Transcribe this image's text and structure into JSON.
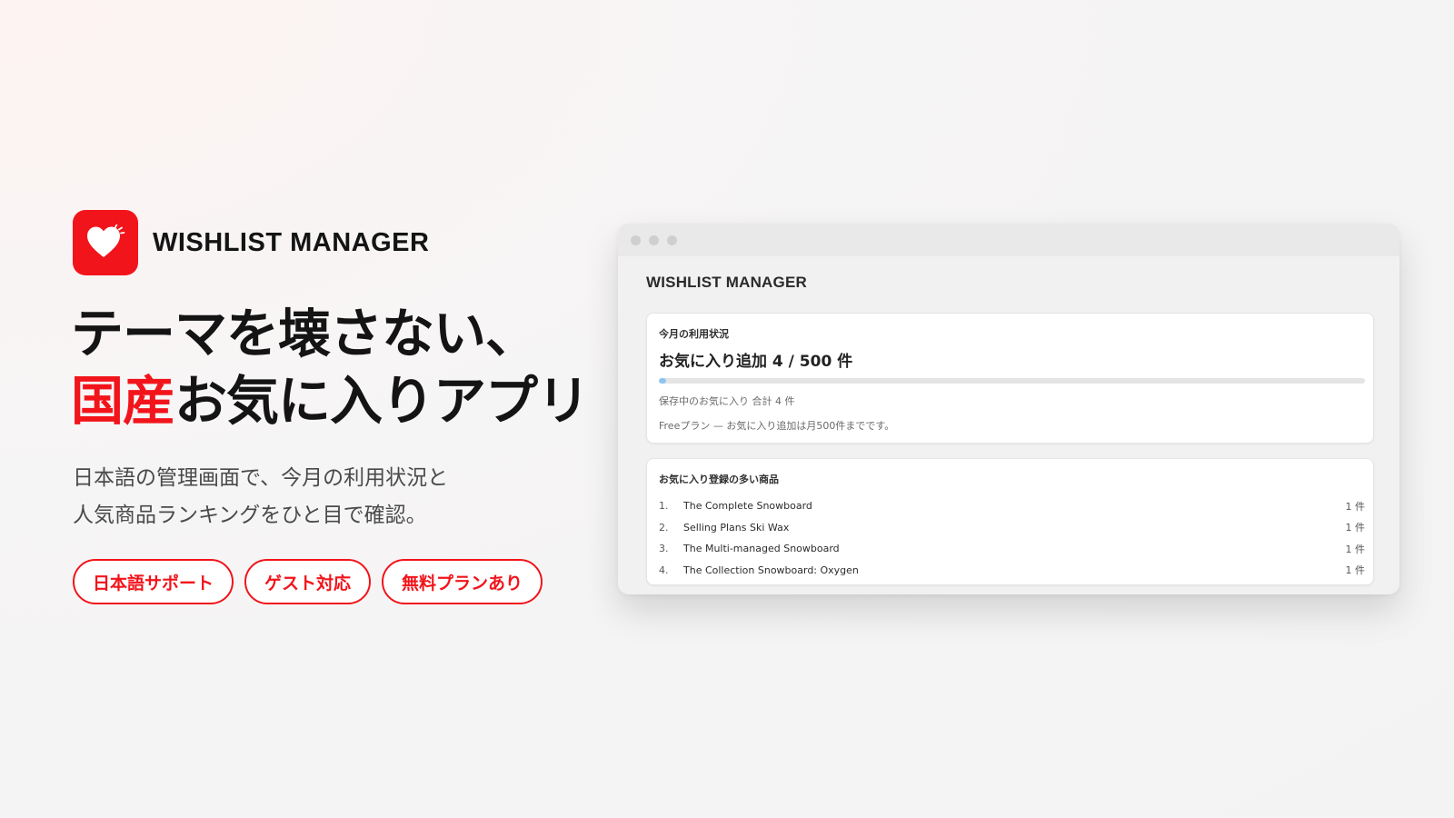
{
  "brand": {
    "name": "WISHLIST MANAGER",
    "logo_icon": "heart-icon",
    "accent_color": "#f2141b"
  },
  "hero": {
    "headline_line1": "テーマを壊さない、",
    "headline_accent": "国産",
    "headline_line2_rest": "お気に入りアプリ",
    "lead_line1": "日本語の管理画面で、今月の利用状況と",
    "lead_line2": "人気商品ランキングをひと目で確認。",
    "pills": [
      "日本語サポート",
      "ゲスト対応",
      "無料プランあり"
    ]
  },
  "window": {
    "app_title": "WISHLIST MANAGER",
    "usage": {
      "title": "今月の利用状況",
      "headline": "お気に入り追加 4 / 500 件",
      "used": 4,
      "limit": 500,
      "saved_text": "保存中のお気に入り 合計 4 件",
      "plan_text": "Freeプラン — お気に入り追加は月500件までです。"
    },
    "ranking": {
      "title": "お気に入り登録の多い商品",
      "items": [
        {
          "rank": "1.",
          "name": "The Complete Snowboard",
          "count": "1 件"
        },
        {
          "rank": "2.",
          "name": "Selling Plans Ski Wax",
          "count": "1 件"
        },
        {
          "rank": "3.",
          "name": "The Multi-managed Snowboard",
          "count": "1 件"
        },
        {
          "rank": "4.",
          "name": "The Collection Snowboard: Oxygen",
          "count": "1 件"
        }
      ]
    }
  }
}
